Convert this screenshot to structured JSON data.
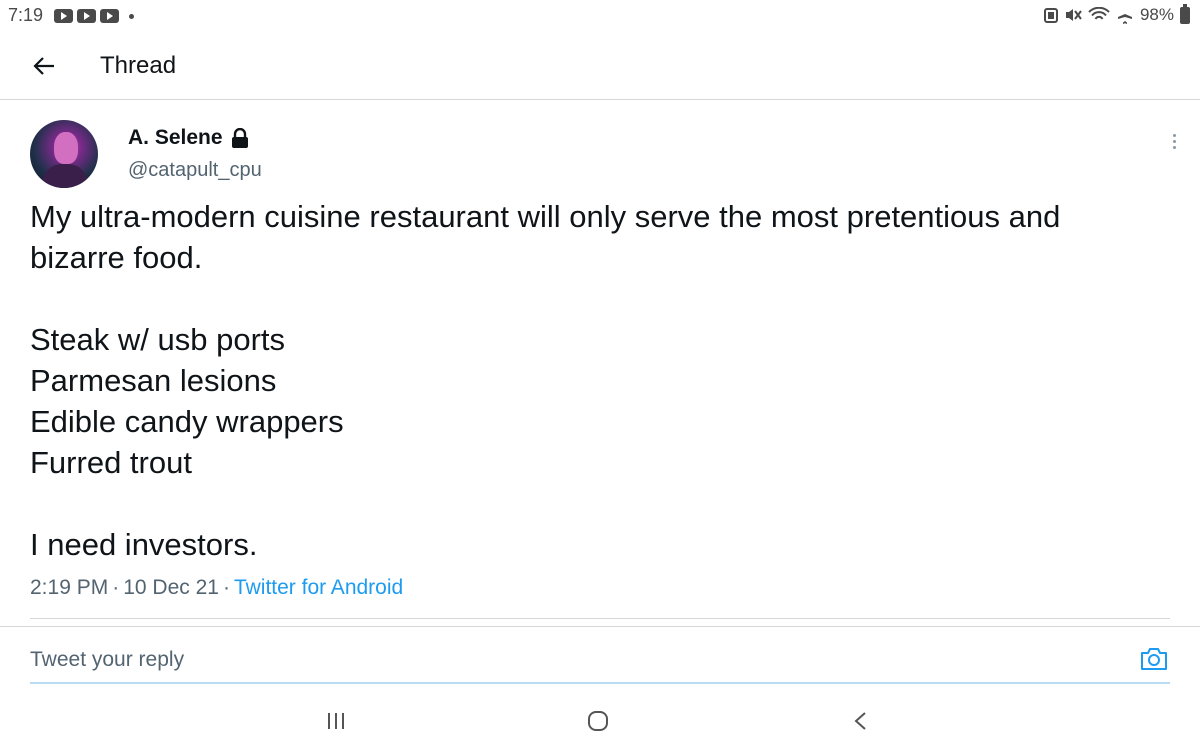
{
  "status_bar": {
    "time": "7:19",
    "battery": "98%",
    "notification_icons": [
      "youtube-icon",
      "youtube-icon",
      "youtube-icon"
    ]
  },
  "header": {
    "title": "Thread",
    "back_icon": "arrow-left-icon"
  },
  "tweet": {
    "display_name": "A. Selene",
    "handle": "@catapult_cpu",
    "protected_icon": "lock-icon",
    "text_intro": [
      "My ultra-modern cuisine restaurant will only serve the most pretentious and",
      "bizarre food."
    ],
    "menu_items": [
      "Steak w/ usb ports",
      "Parmesan lesions",
      "Edible candy wrappers",
      "Furred trout"
    ],
    "text_outro": "I need investors.",
    "time": "2:19 PM",
    "date": "10 Dec 21",
    "source": "Twitter for Android",
    "separator": "·"
  },
  "reply": {
    "placeholder": "Tweet your reply",
    "camera_icon": "camera-icon"
  },
  "colors": {
    "accent": "#1d9bf0",
    "text_primary": "#0f1419",
    "text_secondary": "#536471",
    "divider": "#d6d9db"
  }
}
